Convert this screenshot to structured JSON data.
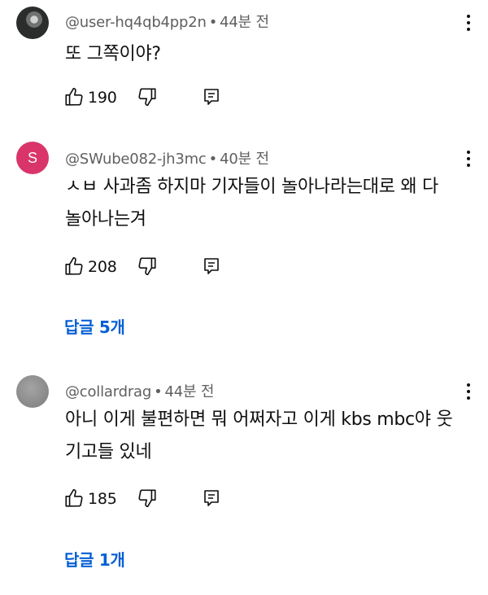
{
  "comments": [
    {
      "author": "@user-hq4qb4pp2n",
      "time": "44분 전",
      "text": "또 그쪽이야?",
      "likes": "190",
      "avatar_type": "photo"
    },
    {
      "author": "@SWube082-jh3mc",
      "time": "40분 전",
      "text": "ㅅㅂ 사과좀 하지마 기자들이 놀아나라는대로 왜 다 놀아나는겨",
      "likes": "208",
      "avatar_type": "letter",
      "avatar_letter": "S",
      "avatar_color": "#d9356a",
      "replies_label": "답글 5개"
    },
    {
      "author": "@collardrag",
      "time": "44분 전",
      "text": "아니 이게 불편하면 뭐 어쩌자고 이게 kbs mbc야 웃기고들 있네",
      "likes": "185",
      "avatar_type": "gray",
      "replies_label": "답글 1개"
    }
  ],
  "separator": "•",
  "icons": {
    "like": "thumb-up-icon",
    "dislike": "thumb-down-icon",
    "reply": "reply-icon",
    "more": "more-vertical-icon"
  },
  "colors": {
    "link": "#065fd4",
    "meta": "#606060",
    "text": "#0f0f0f"
  }
}
